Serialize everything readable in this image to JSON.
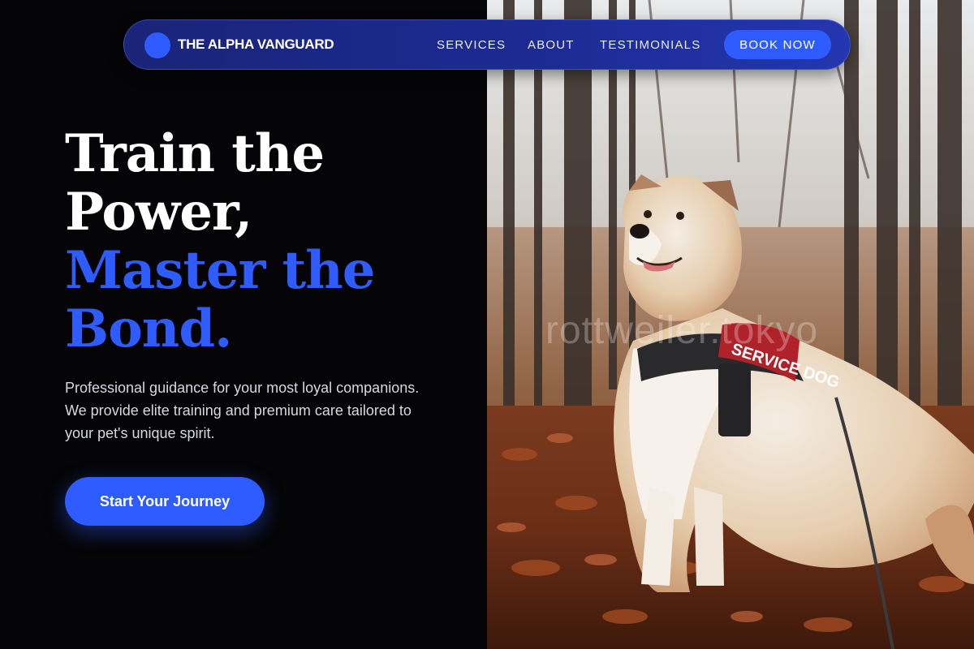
{
  "app": {
    "brand_name": "THE ALPHA VANGUARD"
  },
  "nav": {
    "items": [
      {
        "label": "SERVICES"
      },
      {
        "label": "ABOUT"
      },
      {
        "label": "TESTIMONIALS"
      }
    ],
    "book_label": "BOOK NOW"
  },
  "hero": {
    "headline_line1": "Train the",
    "headline_line2": "Power,",
    "headline_line3": "Master the",
    "headline_line4": "Bond.",
    "subtext": "Professional guidance for your most loyal companions. We provide elite training and premium care tailored to your pet's unique spirit.",
    "cta_label": "Start Your Journey"
  },
  "photo": {
    "subject": "service-dog-in-autumn-forest",
    "harness_text": "SERVICE DOG",
    "watermark": "rottweiler.tokyo"
  },
  "colors": {
    "background": "#050507",
    "accent": "#2f5cff",
    "nav_bg": "#1c2a92",
    "headline_white": "#ffffff"
  }
}
